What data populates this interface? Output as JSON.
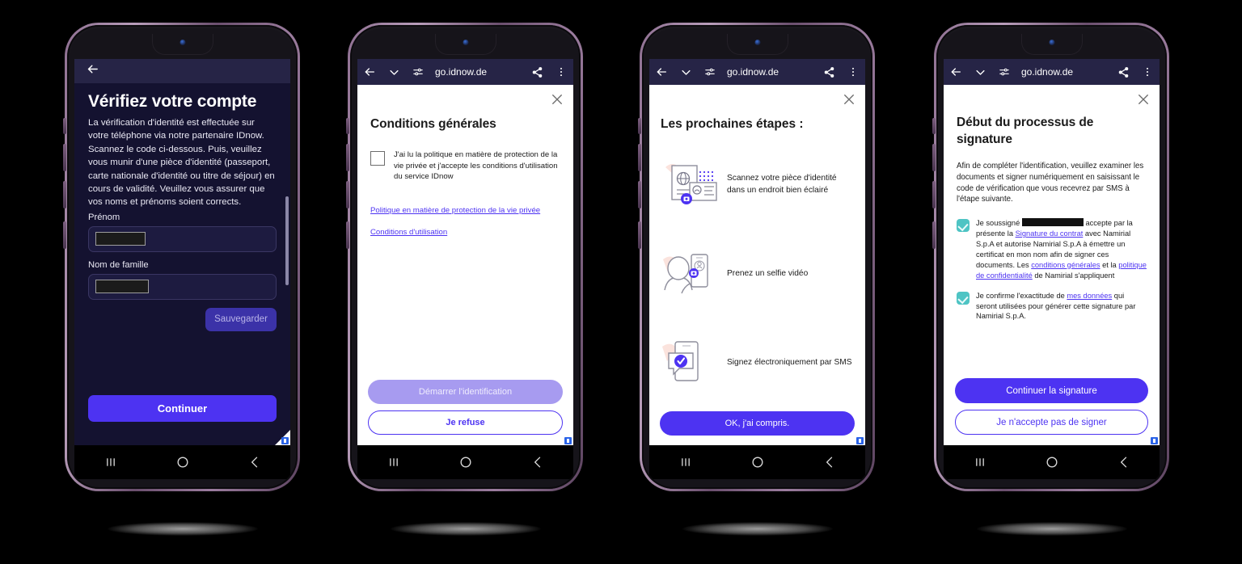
{
  "browser": {
    "url": "go.idnow.de",
    "icons": [
      "back-arrow-icon",
      "chevron-down-icon",
      "tune-icon",
      "share-icon",
      "overflow-menu-icon"
    ]
  },
  "colors": {
    "brand_purple": "#4d33f2",
    "app_dark_bg": "#141230",
    "app_topbar": "#262446",
    "checkbox_teal": "#4ec4c4",
    "link": "#4d33f2",
    "disabled_button": "#a79bf0"
  },
  "phone1": {
    "back_icon": "back-arrow-icon",
    "title": "Vérifiez votre compte",
    "intro": "La vérification d'identité est effectuée sur votre téléphone via notre partenaire IDnow. Scannez le code ci-dessous. Puis, veuillez vous munir d'une pièce d'identité (passeport, carte nationale d'identité ou titre de séjour) en cours de validité. Veuillez vous assurer que vos noms et prénoms soient corrects.",
    "field_firstname_label": "Prénom",
    "field_firstname_value": "",
    "field_lastname_label": "Nom de famille",
    "field_lastname_value": "",
    "save_button": "Sauvegarder",
    "continue_button": "Continuer"
  },
  "phone2": {
    "close_icon": "close-icon",
    "title": "Conditions générales",
    "checkbox_label": "J'ai lu la politique en matière de protection de la vie privée et j'accepte les conditions d'utilisation du service IDnow",
    "checkbox_checked": false,
    "link_privacy": "Politique en matière de protection de la vie privée",
    "link_terms": "Conditions d'utilisation",
    "primary_button": "Démarrer l'identification",
    "secondary_button": "Je refuse"
  },
  "phone3": {
    "close_icon": "close-icon",
    "title": "Les prochaines étapes :",
    "steps": [
      {
        "icon": "id-document-scan-icon",
        "text": "Scannez votre pièce d'identité dans un endroit bien éclairé"
      },
      {
        "icon": "video-selfie-icon",
        "text": "Prenez un selfie vidéo"
      },
      {
        "icon": "sms-signature-icon",
        "text": "Signez électroniquement par SMS"
      }
    ],
    "primary_button": "OK, j'ai compris."
  },
  "phone4": {
    "close_icon": "close-icon",
    "title": "Début du processus de signature",
    "lead": "Afin de compléter l'identification, veuillez examiner les documents et signer numériquement en saisissant le code de vérification que vous recevrez par SMS à l'étape suivante.",
    "consent1": {
      "checked": true,
      "p1": "Je soussigné",
      "redacted": true,
      "p2": "accepte par la présente la",
      "link1": "Signature du contrat",
      "p3": "avec Namirial S.p.A et autorise Namirial S.p.A à émettre un certificat en mon nom afin de signer ces documents. Les",
      "link2": "conditions générales",
      "p4": "et la",
      "link3": "politique de confidentialité",
      "p5": "de Namirial s'appliquent"
    },
    "consent2": {
      "checked": true,
      "p1": "Je confirme l'exactitude de",
      "link1": "mes données",
      "p2": "qui seront utilisées pour générer cette signature par Namirial S.p.A."
    },
    "primary_button": "Continuer la signature",
    "secondary_button": "Je n'accepte pas de signer"
  },
  "android_nav": {
    "recents": "recents-button",
    "home": "home-button",
    "back": "back-button"
  }
}
